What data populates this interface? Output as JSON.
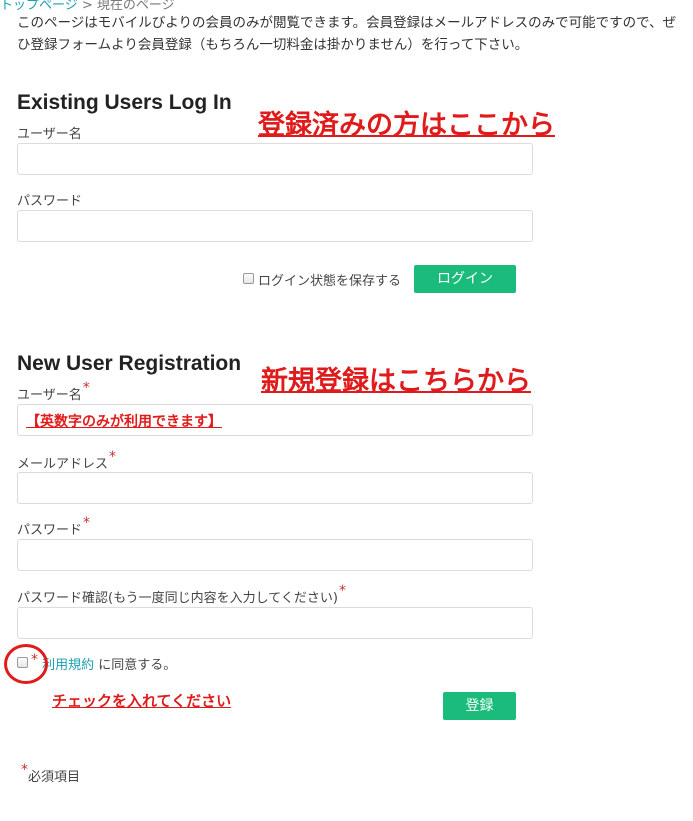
{
  "breadcrumb": {
    "home": "トップページ",
    "sep": " > ",
    "current": "現在のページ"
  },
  "intro": "このページはモバイルびよりの会員のみが閲覧できます。会員登録はメールアドレスのみで可能ですので、ぜひ登録フォームより会員登録（もちろん一切料金は掛かりません）を行って下さい。",
  "login": {
    "title": "Existing Users Log In",
    "annotation": "登録済みの方はここから",
    "username_label": "ユーザー名",
    "password_label": "パスワード",
    "remember_label": "ログイン状態を保存する",
    "submit_label": "ログイン"
  },
  "registration": {
    "title": "New User Registration",
    "annotation": "新規登録はこちらから",
    "required_mark": "*",
    "username_label": "ユーザー名",
    "username_annotation": "【英数字のみが利用できます】",
    "email_label": "メールアドレス",
    "password_label": "パスワード",
    "confirm_label": "パスワード確認(もう一度同じ内容を入力してください)",
    "terms_link": "利用規約",
    "terms_suffix": " に同意する。",
    "check_annotation": "チェックを入れてください",
    "submit_label": "登録",
    "required_note": "必須項目"
  },
  "colors": {
    "accent_button": "#1bbc7b",
    "annotation_red": "#e01b1b",
    "link": "#1a9fb3"
  }
}
